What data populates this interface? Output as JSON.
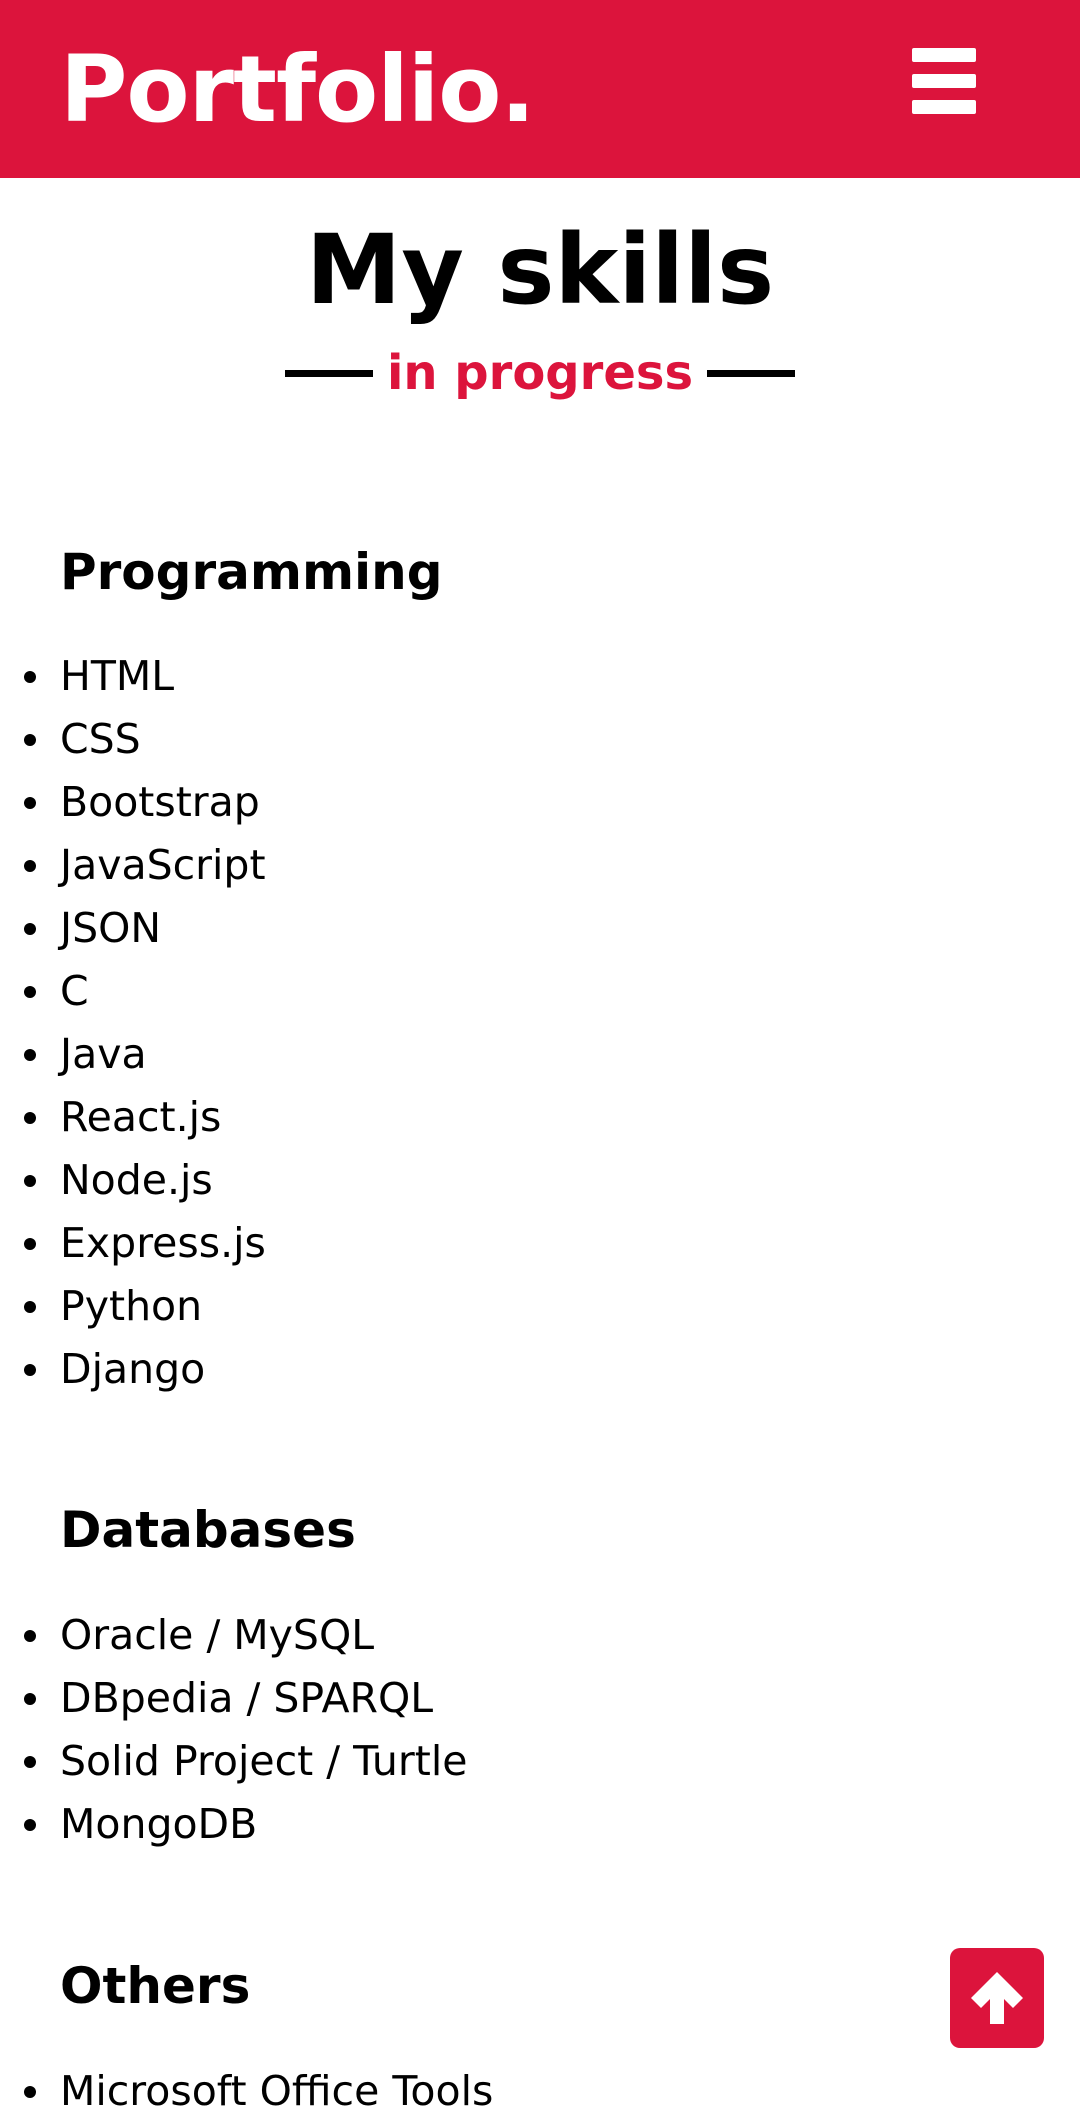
{
  "header": {
    "brand": "Portfolio.",
    "menu_icon": "hamburger-icon",
    "color": "#dc143c"
  },
  "hero": {
    "title": "My skills",
    "subtitle": "in progress"
  },
  "sections": [
    {
      "title": "Programming",
      "items": [
        "HTML",
        "CSS",
        "Bootstrap",
        "JavaScript",
        "JSON",
        "C",
        "Java",
        "React.js",
        "Node.js",
        "Express.js",
        "Python",
        "Django"
      ]
    },
    {
      "title": "Databases",
      "items": [
        "Oracle / MySQL",
        "DBpedia / SPARQL",
        "Solid Project / Turtle",
        "MongoDB"
      ]
    },
    {
      "title": "Others",
      "items": [
        "Microsoft Office Tools"
      ]
    }
  ],
  "scroll_top": {
    "icon": "arrow-up-icon"
  }
}
